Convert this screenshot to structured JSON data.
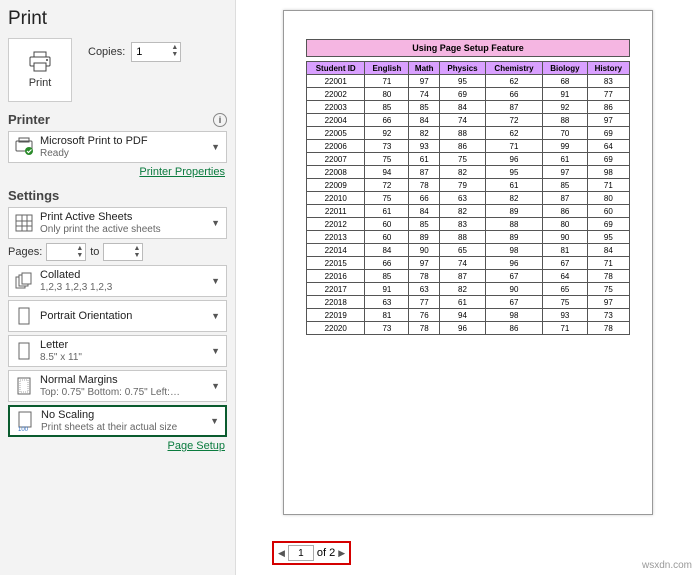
{
  "heading": "Print",
  "printBtn": "Print",
  "copies": {
    "label": "Copies:",
    "value": "1"
  },
  "printer": {
    "heading": "Printer",
    "name": "Microsoft Print to PDF",
    "status": "Ready",
    "propsLink": "Printer Properties"
  },
  "settings": {
    "heading": "Settings",
    "sheets": {
      "t1": "Print Active Sheets",
      "t2": "Only print the active sheets"
    },
    "pages": {
      "label": "Pages:",
      "to": "to"
    },
    "collate": {
      "t1": "Collated",
      "t2": "1,2,3    1,2,3    1,2,3"
    },
    "orient": {
      "t1": "Portrait Orientation"
    },
    "paper": {
      "t1": "Letter",
      "t2": "8.5\" x 11\""
    },
    "margins": {
      "t1": "Normal Margins",
      "t2": "Top: 0.75\" Bottom: 0.75\" Left:…"
    },
    "scaling": {
      "t1": "No Scaling",
      "t2": "Print sheets at their actual size"
    },
    "setupLink": "Page Setup"
  },
  "preview": {
    "banner": "Using Page Setup Feature",
    "headers": [
      "Student ID",
      "English",
      "Math",
      "Physics",
      "Chemistry",
      "Biology",
      "History"
    ],
    "rows": [
      [
        "22001",
        "71",
        "97",
        "95",
        "62",
        "68",
        "83"
      ],
      [
        "22002",
        "80",
        "74",
        "69",
        "66",
        "91",
        "77"
      ],
      [
        "22003",
        "85",
        "85",
        "84",
        "87",
        "92",
        "86"
      ],
      [
        "22004",
        "66",
        "84",
        "74",
        "72",
        "88",
        "97"
      ],
      [
        "22005",
        "92",
        "82",
        "88",
        "62",
        "70",
        "69"
      ],
      [
        "22006",
        "73",
        "93",
        "86",
        "71",
        "99",
        "64"
      ],
      [
        "22007",
        "75",
        "61",
        "75",
        "96",
        "61",
        "69"
      ],
      [
        "22008",
        "94",
        "87",
        "82",
        "95",
        "97",
        "98"
      ],
      [
        "22009",
        "72",
        "78",
        "79",
        "61",
        "85",
        "71"
      ],
      [
        "22010",
        "75",
        "66",
        "63",
        "82",
        "87",
        "80"
      ],
      [
        "22011",
        "61",
        "84",
        "82",
        "89",
        "86",
        "60"
      ],
      [
        "22012",
        "60",
        "85",
        "83",
        "88",
        "80",
        "69"
      ],
      [
        "22013",
        "60",
        "89",
        "88",
        "89",
        "90",
        "95"
      ],
      [
        "22014",
        "84",
        "90",
        "65",
        "98",
        "81",
        "84"
      ],
      [
        "22015",
        "66",
        "97",
        "74",
        "96",
        "67",
        "71"
      ],
      [
        "22016",
        "85",
        "78",
        "87",
        "67",
        "64",
        "78"
      ],
      [
        "22017",
        "91",
        "63",
        "82",
        "90",
        "65",
        "75"
      ],
      [
        "22018",
        "63",
        "77",
        "61",
        "67",
        "75",
        "97"
      ],
      [
        "22019",
        "81",
        "76",
        "94",
        "98",
        "93",
        "73"
      ],
      [
        "22020",
        "73",
        "78",
        "96",
        "86",
        "71",
        "78"
      ]
    ]
  },
  "pager": {
    "current": "1",
    "of": "of 2"
  },
  "watermark": "wsxdn.com"
}
